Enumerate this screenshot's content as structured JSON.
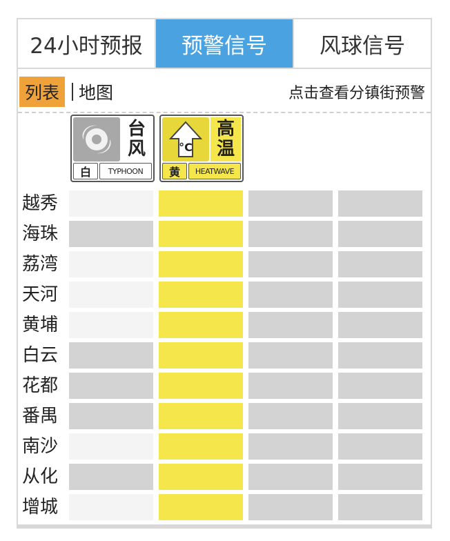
{
  "tabs": [
    {
      "label": "24小时预报",
      "active": false
    },
    {
      "label": "预警信号",
      "active": true
    },
    {
      "label": "风球信号",
      "active": false
    }
  ],
  "subbar": {
    "list_label": "列表",
    "map_label": "地图",
    "link_label": "点击查看分镇街预警"
  },
  "signals": [
    {
      "icon": "typhoon-icon",
      "chars": [
        "台",
        "风"
      ],
      "level": "白",
      "en": "TYPHOON",
      "color": "#ffffff"
    },
    {
      "icon": "thermometer-arrow-icon",
      "chars": [
        "高",
        "温"
      ],
      "level": "黄",
      "en": "HEATWAVE",
      "color": "#f5e74b",
      "pic_text": "°C"
    }
  ],
  "colors": {
    "white_level": "#f4f4f4",
    "gray_none": "#d3d3d3",
    "yellow_level": "#f5e74b"
  },
  "districts": [
    {
      "name": "越秀",
      "cells": [
        "white",
        "yellow",
        "gray",
        "gray"
      ]
    },
    {
      "name": "海珠",
      "cells": [
        "gray",
        "yellow",
        "gray",
        "gray"
      ]
    },
    {
      "name": "荔湾",
      "cells": [
        "white",
        "yellow",
        "gray",
        "gray"
      ]
    },
    {
      "name": "天河",
      "cells": [
        "white",
        "yellow",
        "gray",
        "gray"
      ]
    },
    {
      "name": "黄埔",
      "cells": [
        "white",
        "yellow",
        "gray",
        "gray"
      ]
    },
    {
      "name": "白云",
      "cells": [
        "gray",
        "yellow",
        "gray",
        "gray"
      ]
    },
    {
      "name": "花都",
      "cells": [
        "gray",
        "yellow",
        "gray",
        "gray"
      ]
    },
    {
      "name": "番禺",
      "cells": [
        "gray",
        "yellow",
        "gray",
        "gray"
      ]
    },
    {
      "name": "南沙",
      "cells": [
        "white",
        "yellow",
        "gray",
        "gray"
      ]
    },
    {
      "name": "从化",
      "cells": [
        "gray",
        "yellow",
        "gray",
        "gray"
      ]
    },
    {
      "name": "增城",
      "cells": [
        "white",
        "yellow",
        "gray",
        "gray"
      ]
    }
  ]
}
